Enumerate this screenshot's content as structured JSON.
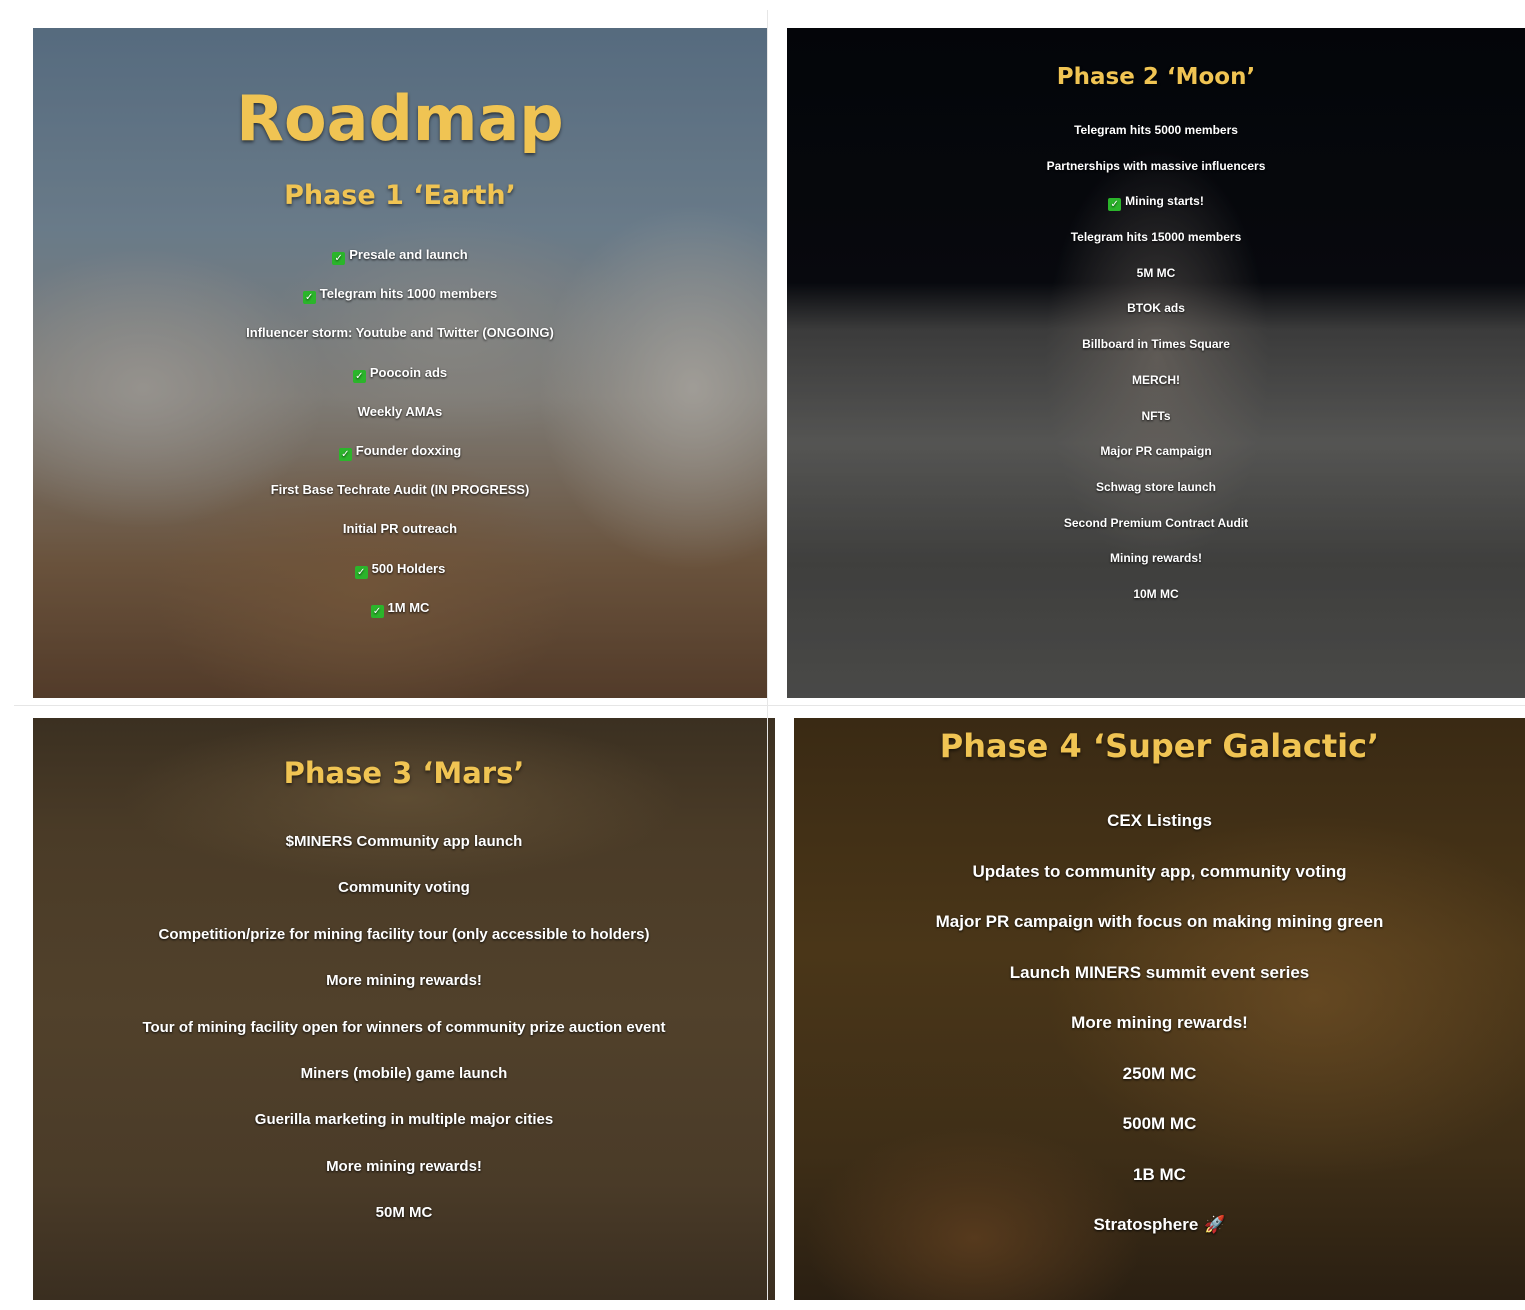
{
  "roadmap_title": "Roadmap",
  "phases": [
    {
      "title": "Phase 1 ‘Earth’",
      "items": [
        {
          "text": "Presale and launch",
          "done": true
        },
        {
          "text": "Telegram hits 1000 members",
          "done": true
        },
        {
          "text": "Influencer storm: Youtube and Twitter (ONGOING)",
          "done": false
        },
        {
          "text": "Poocoin ads",
          "done": true
        },
        {
          "text": "Weekly AMAs",
          "done": false
        },
        {
          "text": "Founder doxxing",
          "done": true
        },
        {
          "text": "First Base Techrate Audit (IN PROGRESS)",
          "done": false
        },
        {
          "text": "Initial PR outreach",
          "done": false
        },
        {
          "text": "500 Holders",
          "done": true
        },
        {
          "text": "1M MC",
          "done": true
        }
      ]
    },
    {
      "title": "Phase 2 ‘Moon’",
      "items": [
        {
          "text": "Telegram hits 5000 members",
          "done": false
        },
        {
          "text": "Partnerships with massive influencers",
          "done": false
        },
        {
          "text": "Mining starts!",
          "done": true
        },
        {
          "text": "Telegram hits 15000 members",
          "done": false
        },
        {
          "text": "5M MC",
          "done": false
        },
        {
          "text": "BTOK ads",
          "done": false
        },
        {
          "text": "Billboard in Times Square",
          "done": false
        },
        {
          "text": "MERCH!",
          "done": false
        },
        {
          "text": "NFTs",
          "done": false
        },
        {
          "text": "Major PR campaign",
          "done": false
        },
        {
          "text": "Schwag store launch",
          "done": false
        },
        {
          "text": "Second Premium Contract Audit",
          "done": false
        },
        {
          "text": "Mining rewards!",
          "done": false
        },
        {
          "text": "10M MC",
          "done": false
        }
      ]
    },
    {
      "title": "Phase 3 ‘Mars’",
      "items": [
        {
          "text": "$MINERS Community app launch",
          "done": false
        },
        {
          "text": "Community voting",
          "done": false
        },
        {
          "text": "Competition/prize for mining facility tour (only accessible to holders)",
          "done": false
        },
        {
          "text": "More mining rewards!",
          "done": false
        },
        {
          "text": "Tour of mining facility open for winners of community prize auction event",
          "done": false
        },
        {
          "text": "Miners (mobile) game launch",
          "done": false
        },
        {
          "text": "Guerilla marketing in multiple major cities",
          "done": false
        },
        {
          "text": "More mining rewards!",
          "done": false
        },
        {
          "text": "50M MC",
          "done": false
        }
      ]
    },
    {
      "title": "Phase 4 ‘Super Galactic’",
      "items": [
        {
          "text": "CEX Listings",
          "done": false
        },
        {
          "text": "Updates to community app, community voting",
          "done": false
        },
        {
          "text": "Major PR campaign with focus on making mining green",
          "done": false
        },
        {
          "text": "Launch MINERS summit event series",
          "done": false
        },
        {
          "text": "More mining rewards!",
          "done": false
        },
        {
          "text": "250M MC",
          "done": false
        },
        {
          "text": "500M MC",
          "done": false
        },
        {
          "text": "1B MC",
          "done": false
        },
        {
          "text": "Stratosphere",
          "done": false
        }
      ]
    }
  ],
  "icons": {
    "check": "check-mark-icon",
    "rocket": "rocket-icon",
    "check_color": "#2bb52b",
    "heading_color": "#f0c453"
  }
}
